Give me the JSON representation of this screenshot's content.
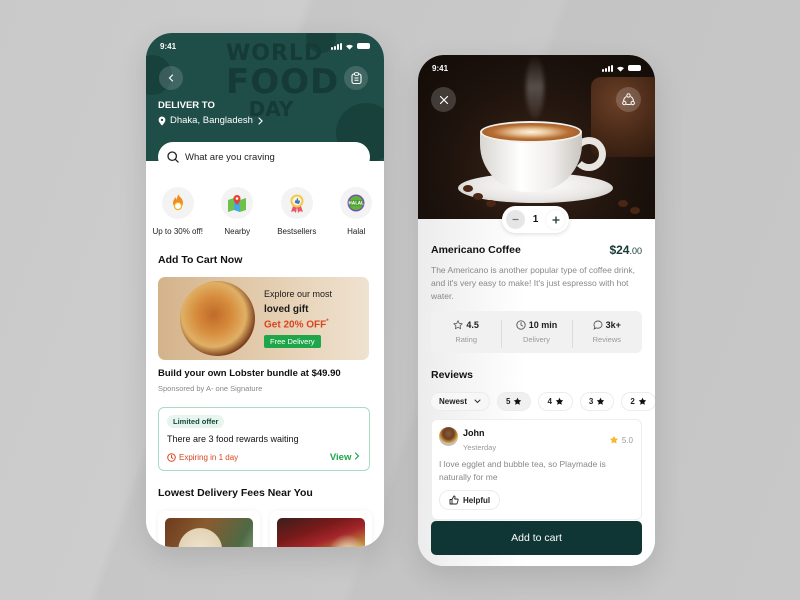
{
  "left_screen": {
    "status_time": "9:41",
    "header_art": {
      "line1": "WORLD",
      "line2": "FOOD",
      "line3": "DAY"
    },
    "deliver_to_label": "DELIVER TO",
    "location": "Dhaka, Bangladesh",
    "search_placeholder": "What are you craving",
    "categories": [
      {
        "label": "Up to 30% off!",
        "icon": "discount-fire-icon"
      },
      {
        "label": "Nearby",
        "icon": "map-pin-icon"
      },
      {
        "label": "Bestsellers",
        "icon": "award-badge-icon"
      },
      {
        "label": "Halal",
        "icon": "halal-badge-icon"
      }
    ],
    "add_to_cart_title": "Add To Cart Now",
    "banner": {
      "line1": "Explore our most",
      "line2": "loved gift",
      "line3": "Get 20% OFF",
      "line3_mark": "*",
      "badge": "Free Delivery"
    },
    "bundle_title": "Build your own Lobster bundle at $49.90",
    "sponsor": "Sponsored by A- one Signature",
    "offer": {
      "badge": "Limited offer",
      "text": "There are 3 food rewards waiting",
      "expiry": "Expiring in 1 day",
      "view_label": "View"
    },
    "lowest_fees_title": "Lowest Delivery Fees Near You"
  },
  "right_screen": {
    "status_time": "9:41",
    "quantity": "1",
    "product_name": "Americano Coffee",
    "price_main": "$24",
    "price_cents": ".00",
    "description": "The Americano is another popular type of coffee drink, and it's very easy to make! It's just espresso with hot water.",
    "stats": [
      {
        "value": "4.5",
        "label": "Rating",
        "icon": "star-outline-icon"
      },
      {
        "value": "10 min",
        "label": "Delivery",
        "icon": "clock-icon"
      },
      {
        "value": "3k+",
        "label": "Reviews",
        "icon": "chat-bubble-icon"
      }
    ],
    "reviews_title": "Reviews",
    "sort_selected": "Newest",
    "rating_filters": [
      "5",
      "4",
      "3",
      "2"
    ],
    "review": {
      "name": "John",
      "date": "Yesterday",
      "score": "5.0",
      "text": "I love egglet and bubble tea, so Playmade is naturally for me",
      "helpful_label": "Helpful"
    },
    "add_to_cart_label": "Add to cart"
  },
  "colors": {
    "brand_dark": "#0f3534",
    "header_green": "#1f4d48",
    "accent_green": "#1fa64a",
    "accent_red": "#d9441f",
    "star_yellow": "#f5b82e"
  }
}
